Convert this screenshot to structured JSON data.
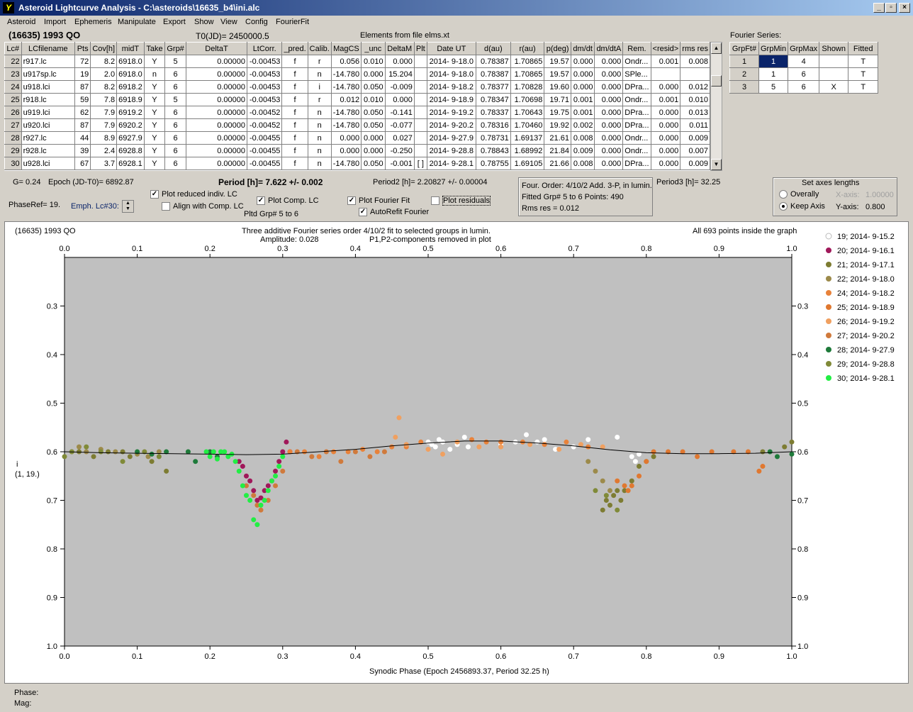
{
  "window": {
    "title": "Asteroid Lightcurve Analysis - C:\\asteroids\\16635_b4\\ini.alc",
    "min_label": "_",
    "max_label": "▫",
    "close_label": "×"
  },
  "menu": [
    "Asteroid",
    "Import",
    "Ephemeris",
    "Manipulate",
    "Export",
    "Show",
    "View",
    "Config",
    "FourierFit"
  ],
  "asteroid": {
    "name": "(16635) 1993 QO",
    "t0": "T0(JD)= 2450000.5",
    "elements": "Elements from file elms.xt"
  },
  "lc_table": {
    "headers": [
      "Lc#",
      "LCfilename",
      "Pts",
      "Cov[h]",
      "midT",
      "Take",
      "Grp#",
      "DeltaT",
      "LtCorr.",
      "_pred.",
      "Calib.",
      "MagCS",
      "_unc",
      "DeltaM",
      "Plt",
      "Date UT",
      "d(au)",
      "r(au)",
      "p(deg)",
      "dm/dt",
      "dm/dtA",
      "Rem.",
      "<resid>",
      "rms res"
    ],
    "rows": [
      [
        "22",
        "r917.lc",
        "72",
        "8.2",
        "6918.0",
        "Y",
        "5",
        "0.00000",
        "-0.00453",
        "f",
        "r",
        "0.056",
        "0.010",
        "0.000",
        "",
        "2014- 9-18.0",
        "0.78387",
        "1.70865",
        "19.57",
        "0.000",
        "0.000",
        "Ondr...",
        "0.001",
        "0.008"
      ],
      [
        "23",
        "u917sp.lc",
        "19",
        "2.0",
        "6918.0",
        "n",
        "6",
        "0.00000",
        "-0.00453",
        "f",
        "n",
        "-14.780",
        "0.000",
        "15.204",
        "",
        "2014- 9-18.0",
        "0.78387",
        "1.70865",
        "19.57",
        "0.000",
        "0.000",
        "SPle...",
        "",
        ""
      ],
      [
        "24",
        "u918.lci",
        "87",
        "8.2",
        "6918.2",
        "Y",
        "6",
        "0.00000",
        "-0.00453",
        "f",
        "i",
        "-14.780",
        "0.050",
        "-0.009",
        "",
        "2014- 9-18.2",
        "0.78377",
        "1.70828",
        "19.60",
        "0.000",
        "0.000",
        "DPra...",
        "0.000",
        "0.012"
      ],
      [
        "25",
        "r918.lc",
        "59",
        "7.8",
        "6918.9",
        "Y",
        "5",
        "0.00000",
        "-0.00453",
        "f",
        "r",
        "0.012",
        "0.010",
        "0.000",
        "",
        "2014- 9-18.9",
        "0.78347",
        "1.70698",
        "19.71",
        "0.001",
        "0.000",
        "Ondr...",
        "0.001",
        "0.010"
      ],
      [
        "26",
        "u919.lci",
        "62",
        "7.9",
        "6919.2",
        "Y",
        "6",
        "0.00000",
        "-0.00452",
        "f",
        "n",
        "-14.780",
        "0.050",
        "-0.141",
        "",
        "2014- 9-19.2",
        "0.78337",
        "1.70643",
        "19.75",
        "0.001",
        "0.000",
        "DPra...",
        "0.000",
        "0.013"
      ],
      [
        "27",
        "u920.lci",
        "87",
        "7.9",
        "6920.2",
        "Y",
        "6",
        "0.00000",
        "-0.00452",
        "f",
        "n",
        "-14.780",
        "0.050",
        "-0.077",
        "",
        "2014- 9-20.2",
        "0.78316",
        "1.70460",
        "19.92",
        "0.002",
        "0.000",
        "DPra...",
        "0.000",
        "0.011"
      ],
      [
        "28",
        "r927.lc",
        "44",
        "8.9",
        "6927.9",
        "Y",
        "6",
        "0.00000",
        "-0.00455",
        "f",
        "n",
        "0.000",
        "0.000",
        "0.027",
        "",
        "2014- 9-27.9",
        "0.78731",
        "1.69137",
        "21.61",
        "0.008",
        "0.000",
        "Ondr...",
        "0.000",
        "0.009"
      ],
      [
        "29",
        "r928.lc",
        "39",
        "2.4",
        "6928.8",
        "Y",
        "6",
        "0.00000",
        "-0.00455",
        "f",
        "n",
        "0.000",
        "0.000",
        "-0.250",
        "",
        "2014- 9-28.8",
        "0.78843",
        "1.68992",
        "21.84",
        "0.009",
        "0.000",
        "Ondr...",
        "0.000",
        "0.007"
      ],
      [
        "30",
        "u928.lci",
        "67",
        "3.7",
        "6928.1",
        "Y",
        "6",
        "0.00000",
        "-0.00455",
        "f",
        "n",
        "-14.780",
        "0.050",
        "-0.001",
        "[ ]",
        "2014- 9-28.1",
        "0.78755",
        "1.69105",
        "21.66",
        "0.008",
        "0.000",
        "DPra...",
        "0.000",
        "0.009"
      ]
    ]
  },
  "fourier_series": {
    "title": "Fourier Series:",
    "headers": [
      "GrpFt#",
      "GrpMin",
      "GrpMax",
      "Shown",
      "Fitted"
    ],
    "rows": [
      [
        "1",
        "1",
        "4",
        "",
        "T"
      ],
      [
        "2",
        "1",
        "6",
        "",
        "T"
      ],
      [
        "3",
        "5",
        "6",
        "X",
        "T"
      ]
    ]
  },
  "info": {
    "g": "G= 0.24",
    "epoch": "Epoch (JD-T0)= 6892.87",
    "period": "Period [h]= 7.622 +/- 0.002",
    "period2": "Period2 [h]= 2.20827 +/- 0.00004",
    "period3": "Period3 [h]= 32.25",
    "phase_ref": "PhaseRef= 19.",
    "emph": "Emph. Lc#30:",
    "four_order": "Four. Order:  4/10/2 Add. 3-P, in lumin.",
    "fitted_grp": "Fitted Grp# 5 to 6    Points: 490",
    "rms": "Rms res    = 0.012",
    "pltd_grp": "Pltd Grp#  5  to  6"
  },
  "checkboxes": {
    "plot_reduced": {
      "label": "Plot reduced indiv. LC",
      "mark": "✓"
    },
    "align_comp": {
      "label": "Align with Comp. LC",
      "mark": ""
    },
    "plot_comp": {
      "label": "Plot Comp. LC",
      "mark": "✓"
    },
    "plot_fourier": {
      "label": "Plot Fourier Fit",
      "mark": "✓"
    },
    "autorefit": {
      "label": "AutoRefit Fourier",
      "mark": "✓"
    },
    "plot_residuals": {
      "label": "Plot residuals",
      "mark": ""
    }
  },
  "axes_box": {
    "title": "Set axes lengths",
    "overally": "Overally",
    "keep_axis": "Keep Axis",
    "x_axis": "X-axis:",
    "x_val": "1.00000",
    "y_axis": "Y-axis:",
    "y_val": "0.800"
  },
  "plot": {
    "obj": "(16635) 1993 QO",
    "desc1": "Three additive Fourier series order 4/10/2 fit to selected groups in lumin.",
    "desc2": "Amplitude: 0.028",
    "desc3": "P1,P2-components removed in plot",
    "inside": "All 693 points inside the graph",
    "ylabel1": "i",
    "ylabel2": "(1, 19.)",
    "xlabel": "Synodic Phase (Epoch 2456893.37, Period 32.25 h)"
  },
  "chart_data": {
    "type": "scatter",
    "x_ticks": [
      "0.0",
      "0.1",
      "0.2",
      "0.3",
      "0.4",
      "0.5",
      "0.6",
      "0.7",
      "0.8",
      "0.9",
      "1.0"
    ],
    "y_ticks": [
      "0.3",
      "0.4",
      "0.5",
      "0.6",
      "0.7",
      "0.8",
      "0.9",
      "1.0"
    ],
    "xlim": [
      0,
      1
    ],
    "ylim": [
      0.2,
      1.0
    ],
    "y_inverted": true,
    "series": [
      {
        "name": "19; 2014- 9-15.2",
        "color": "#ffffff",
        "points": [
          [
            0.5,
            0.58
          ],
          [
            0.505,
            0.585
          ],
          [
            0.51,
            0.59
          ],
          [
            0.515,
            0.575
          ],
          [
            0.52,
            0.58
          ],
          [
            0.53,
            0.595
          ],
          [
            0.54,
            0.585
          ],
          [
            0.55,
            0.57
          ],
          [
            0.555,
            0.59
          ],
          [
            0.6,
            0.585
          ],
          [
            0.62,
            0.58
          ],
          [
            0.635,
            0.565
          ],
          [
            0.65,
            0.58
          ],
          [
            0.66,
            0.575
          ],
          [
            0.675,
            0.595
          ],
          [
            0.7,
            0.59
          ],
          [
            0.72,
            0.575
          ],
          [
            0.76,
            0.57
          ],
          [
            0.78,
            0.61
          ],
          [
            0.785,
            0.62
          ],
          [
            0.79,
            0.605
          ]
        ]
      },
      {
        "name": "20; 2014- 9-16.1",
        "color": "#a0185a",
        "points": [
          [
            0.24,
            0.62
          ],
          [
            0.245,
            0.63
          ],
          [
            0.25,
            0.65
          ],
          [
            0.255,
            0.66
          ],
          [
            0.26,
            0.68
          ],
          [
            0.265,
            0.7
          ],
          [
            0.27,
            0.695
          ],
          [
            0.275,
            0.68
          ],
          [
            0.28,
            0.67
          ],
          [
            0.285,
            0.66
          ],
          [
            0.29,
            0.64
          ],
          [
            0.295,
            0.62
          ],
          [
            0.3,
            0.6
          ],
          [
            0.305,
            0.58
          ],
          [
            0.31,
            0.6
          ]
        ]
      },
      {
        "name": "21; 2014- 9-17.1",
        "color": "#7d7c32",
        "points": [
          [
            0.02,
            0.6
          ],
          [
            0.04,
            0.61
          ],
          [
            0.06,
            0.6
          ],
          [
            0.08,
            0.6
          ],
          [
            0.09,
            0.61
          ],
          [
            0.12,
            0.62
          ],
          [
            0.14,
            0.64
          ],
          [
            0.74,
            0.72
          ],
          [
            0.745,
            0.7
          ],
          [
            0.75,
            0.71
          ],
          [
            0.755,
            0.69
          ],
          [
            0.76,
            0.68
          ],
          [
            0.765,
            0.7
          ],
          [
            0.77,
            0.68
          ],
          [
            0.78,
            0.66
          ],
          [
            0.79,
            0.63
          ],
          [
            0.8,
            0.62
          ],
          [
            0.81,
            0.61
          ],
          [
            0.96,
            0.6
          ],
          [
            0.99,
            0.59
          ],
          [
            1.0,
            0.58
          ]
        ]
      },
      {
        "name": "22; 2014- 9-18.0",
        "color": "#9c8a4a",
        "points": [
          [
            0.01,
            0.6
          ],
          [
            0.02,
            0.59
          ],
          [
            0.03,
            0.6
          ],
          [
            0.05,
            0.595
          ],
          [
            0.07,
            0.6
          ],
          [
            0.1,
            0.605
          ],
          [
            0.115,
            0.61
          ],
          [
            0.13,
            0.6
          ],
          [
            0.72,
            0.62
          ],
          [
            0.73,
            0.64
          ],
          [
            0.74,
            0.66
          ],
          [
            0.75,
            0.68
          ]
        ]
      },
      {
        "name": "24; 2014- 9-18.2",
        "color": "#e8823a",
        "points": [
          [
            0.31,
            0.6
          ],
          [
            0.33,
            0.6
          ],
          [
            0.35,
            0.61
          ],
          [
            0.37,
            0.6
          ],
          [
            0.39,
            0.6
          ],
          [
            0.41,
            0.595
          ],
          [
            0.43,
            0.6
          ],
          [
            0.45,
            0.59
          ],
          [
            0.47,
            0.59
          ],
          [
            0.49,
            0.58
          ],
          [
            0.56,
            0.575
          ],
          [
            0.58,
            0.58
          ],
          [
            0.6,
            0.58
          ],
          [
            0.63,
            0.58
          ],
          [
            0.66,
            0.585
          ],
          [
            0.69,
            0.58
          ],
          [
            0.72,
            0.59
          ]
        ]
      },
      {
        "name": "25; 2014- 9-18.9",
        "color": "#e07830",
        "points": [
          [
            0.76,
            0.66
          ],
          [
            0.77,
            0.67
          ],
          [
            0.775,
            0.68
          ],
          [
            0.78,
            0.67
          ],
          [
            0.79,
            0.65
          ],
          [
            0.8,
            0.62
          ],
          [
            0.81,
            0.6
          ],
          [
            0.83,
            0.6
          ],
          [
            0.85,
            0.6
          ],
          [
            0.87,
            0.61
          ],
          [
            0.89,
            0.6
          ],
          [
            0.92,
            0.6
          ],
          [
            0.94,
            0.6
          ],
          [
            0.955,
            0.64
          ],
          [
            0.96,
            0.63
          ]
        ]
      },
      {
        "name": "26; 2014- 9-19.2",
        "color": "#f0a060",
        "points": [
          [
            0.455,
            0.57
          ],
          [
            0.46,
            0.53
          ],
          [
            0.47,
            0.585
          ],
          [
            0.5,
            0.595
          ],
          [
            0.52,
            0.605
          ],
          [
            0.54,
            0.58
          ],
          [
            0.57,
            0.59
          ],
          [
            0.6,
            0.59
          ],
          [
            0.64,
            0.585
          ],
          [
            0.68,
            0.595
          ],
          [
            0.71,
            0.585
          ],
          [
            0.74,
            0.59
          ]
        ]
      },
      {
        "name": "27; 2014- 9-20.2",
        "color": "#d07a3c",
        "points": [
          [
            0.25,
            0.67
          ],
          [
            0.26,
            0.69
          ],
          [
            0.265,
            0.71
          ],
          [
            0.27,
            0.72
          ],
          [
            0.28,
            0.7
          ],
          [
            0.29,
            0.67
          ],
          [
            0.3,
            0.64
          ],
          [
            0.32,
            0.6
          ],
          [
            0.34,
            0.61
          ],
          [
            0.36,
            0.6
          ],
          [
            0.38,
            0.62
          ],
          [
            0.4,
            0.6
          ],
          [
            0.42,
            0.61
          ],
          [
            0.44,
            0.6
          ]
        ]
      },
      {
        "name": "28; 2014- 9-27.9",
        "color": "#1e7a3a",
        "points": [
          [
            0.1,
            0.6
          ],
          [
            0.12,
            0.605
          ],
          [
            0.14,
            0.6
          ],
          [
            0.17,
            0.6
          ],
          [
            0.18,
            0.62
          ],
          [
            0.2,
            0.6
          ],
          [
            0.21,
            0.61
          ],
          [
            0.97,
            0.6
          ],
          [
            0.98,
            0.61
          ],
          [
            1.0,
            0.605
          ]
        ]
      },
      {
        "name": "29; 2014- 9-28.8",
        "color": "#808a38",
        "points": [
          [
            0.0,
            0.61
          ],
          [
            0.01,
            0.6
          ],
          [
            0.03,
            0.59
          ],
          [
            0.05,
            0.6
          ],
          [
            0.08,
            0.62
          ],
          [
            0.11,
            0.6
          ],
          [
            0.13,
            0.61
          ],
          [
            0.73,
            0.68
          ],
          [
            0.745,
            0.69
          ],
          [
            0.76,
            0.72
          ]
        ]
      },
      {
        "name": "30; 2014- 9-28.1",
        "color": "#22ee44",
        "points": [
          [
            0.195,
            0.6
          ],
          [
            0.2,
            0.61
          ],
          [
            0.205,
            0.6
          ],
          [
            0.21,
            0.615
          ],
          [
            0.215,
            0.6
          ],
          [
            0.22,
            0.6
          ],
          [
            0.225,
            0.61
          ],
          [
            0.23,
            0.605
          ],
          [
            0.235,
            0.62
          ],
          [
            0.24,
            0.64
          ],
          [
            0.245,
            0.67
          ],
          [
            0.25,
            0.69
          ],
          [
            0.255,
            0.7
          ],
          [
            0.26,
            0.74
          ],
          [
            0.265,
            0.75
          ],
          [
            0.27,
            0.71
          ],
          [
            0.275,
            0.7
          ],
          [
            0.28,
            0.68
          ],
          [
            0.285,
            0.66
          ],
          [
            0.29,
            0.65
          ],
          [
            0.295,
            0.63
          ],
          [
            0.3,
            0.61
          ]
        ]
      }
    ],
    "fit_curve": [
      [
        0.0,
        0.6
      ],
      [
        0.05,
        0.602
      ],
      [
        0.1,
        0.603
      ],
      [
        0.15,
        0.604
      ],
      [
        0.2,
        0.605
      ],
      [
        0.25,
        0.606
      ],
      [
        0.3,
        0.605
      ],
      [
        0.35,
        0.6
      ],
      [
        0.4,
        0.595
      ],
      [
        0.45,
        0.588
      ],
      [
        0.5,
        0.582
      ],
      [
        0.55,
        0.578
      ],
      [
        0.6,
        0.578
      ],
      [
        0.65,
        0.582
      ],
      [
        0.7,
        0.588
      ],
      [
        0.75,
        0.596
      ],
      [
        0.8,
        0.602
      ],
      [
        0.85,
        0.604
      ],
      [
        0.9,
        0.604
      ],
      [
        0.95,
        0.603
      ],
      [
        1.0,
        0.6
      ]
    ]
  },
  "status": {
    "phase": "Phase:",
    "mag": "Mag:"
  }
}
